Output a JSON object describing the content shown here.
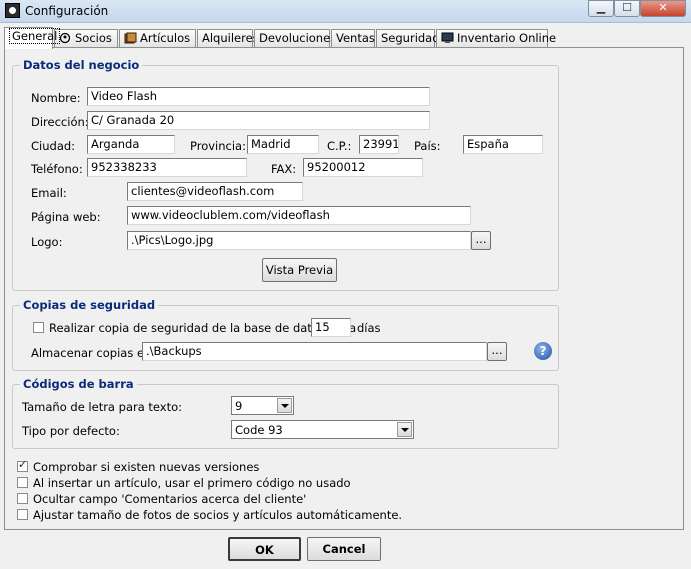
{
  "window": {
    "title": "Configuración",
    "icon": "film-reel-icon"
  },
  "tabs": [
    {
      "label": "General",
      "icon": ""
    },
    {
      "label": "Socios",
      "icon": "member-icon"
    },
    {
      "label": "Artículos",
      "icon": "book-icon"
    },
    {
      "label": "Alquileres",
      "icon": ""
    },
    {
      "label": "Devoluciones",
      "icon": ""
    },
    {
      "label": "Ventas",
      "icon": ""
    },
    {
      "label": "Seguridad",
      "icon": ""
    },
    {
      "label": "Inventario Online",
      "icon": "monitor-icon"
    }
  ],
  "negocio": {
    "title": "Datos del negocio",
    "nombre_label": "Nombre:",
    "nombre": "Video Flash",
    "direccion_label": "Dirección:",
    "direccion": "C/ Granada 20",
    "ciudad_label": "Ciudad:",
    "ciudad": "Arganda",
    "provincia_label": "Provincia:",
    "provincia": "Madrid",
    "cp_label": "C.P.:",
    "cp": "23991",
    "pais_label": "País:",
    "pais": "España",
    "telefono_label": "Teléfono:",
    "telefono": "952338233",
    "fax_label": "FAX:",
    "fax": "95200012",
    "email_label": "Email:",
    "email": "clientes@videoflash.com",
    "web_label": "Página web:",
    "web": "www.videoclublem.com/videoflash",
    "logo_label": "Logo:",
    "logo": ".\\Pics\\Logo.jpg",
    "browse_label": "...",
    "preview_label": "Vista Previa"
  },
  "backup": {
    "title": "Copias de seguridad",
    "check_label": "Realizar copia de seguridad de la base de datos cada",
    "check_checked": false,
    "days": "15",
    "days_label": "días",
    "store_label": "Almacenar copias en:",
    "store_path": ".\\Backups",
    "browse_label": "...",
    "help_glyph": "?"
  },
  "barcode": {
    "title": "Códigos de barra",
    "font_size_label": "Tamaño de letra para texto:",
    "font_size": "9",
    "type_label": "Tipo por defecto:",
    "type": "Code 93"
  },
  "options": [
    {
      "label": "Comprobar si existen nuevas versiones",
      "checked": true
    },
    {
      "label": "Al insertar un artículo, usar el primero código no usado",
      "checked": false
    },
    {
      "label": "Ocultar campo 'Comentarios acerca del cliente'",
      "checked": false
    },
    {
      "label": "Ajustar tamaño de fotos de socios y artículos automáticamente.",
      "checked": false
    }
  ],
  "footer": {
    "ok_label": "OK",
    "cancel_label": "Cancel"
  }
}
